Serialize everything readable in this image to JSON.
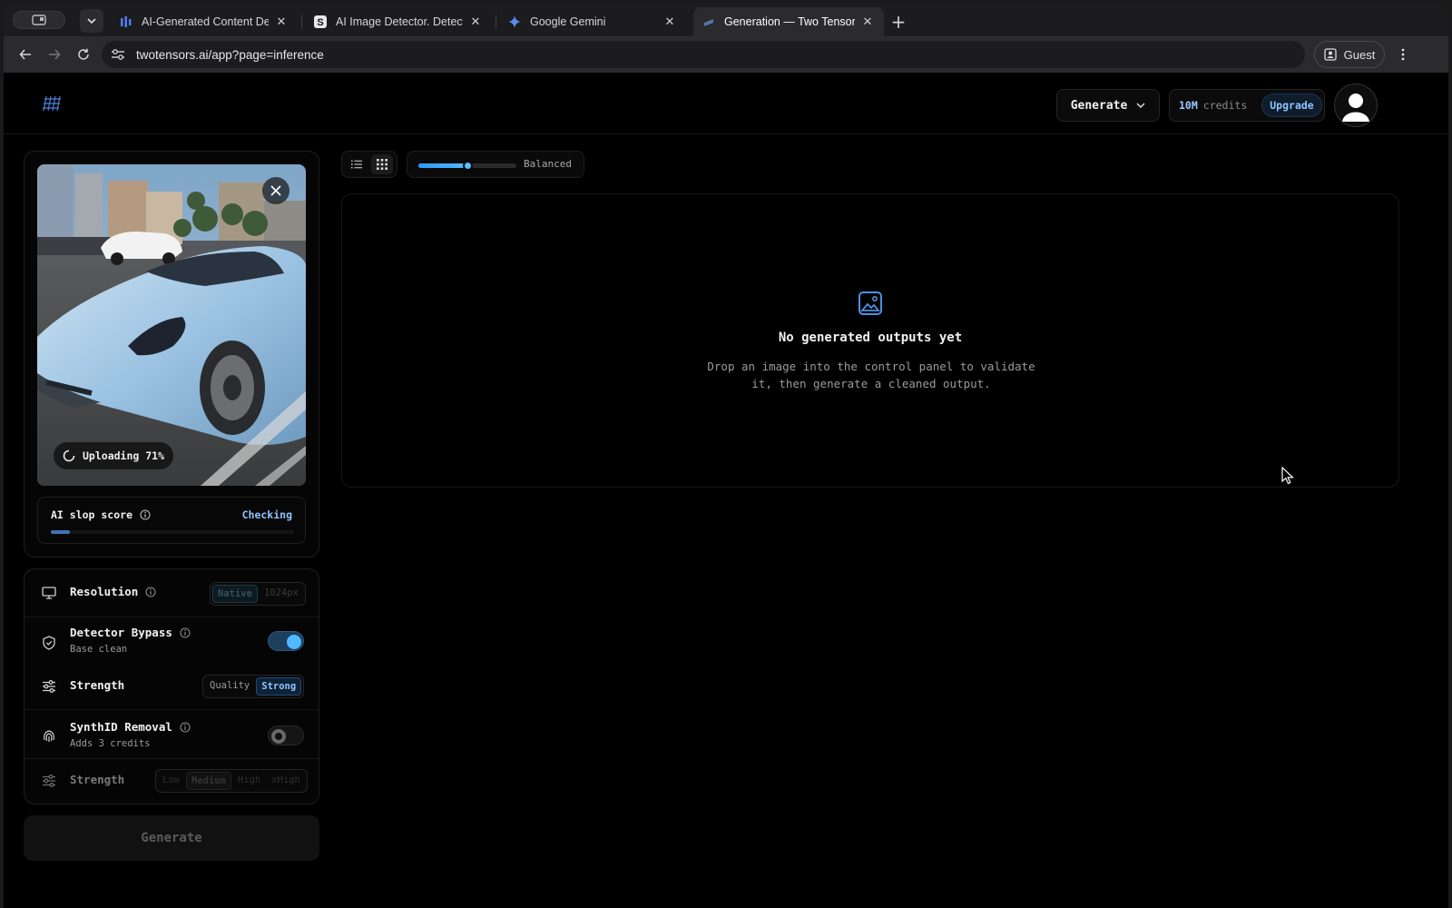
{
  "browser": {
    "tabs": [
      {
        "title": "AI-Generated Content Detect",
        "favicon": "bars-icon"
      },
      {
        "title": "AI Image Detector. Detect AI-",
        "favicon": "s-logo-icon"
      },
      {
        "title": "Google Gemini",
        "favicon": "gemini-icon"
      },
      {
        "title": "Generation — Two Tensors",
        "favicon": "twotensors-icon"
      }
    ],
    "active_tab": 3,
    "url": "twotensors.ai/app?page=inference",
    "profile_label": "Guest"
  },
  "header": {
    "mode_select": "Generate",
    "credits_amount": "10M",
    "credits_label": "credits",
    "upgrade_label": "Upgrade"
  },
  "upload": {
    "status_text": "Uploading 71%",
    "progress_percent": 71
  },
  "slop_score": {
    "label": "AI slop score",
    "status": "Checking",
    "progress_fraction": 0.08
  },
  "settings": {
    "resolution": {
      "label": "Resolution",
      "options": [
        "Native",
        "1024px"
      ],
      "selected": "Native"
    },
    "detector_bypass": {
      "label": "Detector Bypass",
      "sub": "Base clean",
      "enabled": true
    },
    "strength": {
      "label": "Strength",
      "options": [
        "Quality",
        "Strong"
      ],
      "selected": "Strong"
    },
    "synthid": {
      "label": "SynthID Removal",
      "sub": "Adds 3 credits",
      "enabled": false
    },
    "synthid_strength": {
      "label": "Strength",
      "options": [
        "Low",
        "Medium",
        "High",
        "xHigh"
      ],
      "selected": "Medium",
      "disabled": true
    }
  },
  "generate_button": "Generate",
  "view": {
    "mode": "grid",
    "quality_label": "Balanced",
    "quality_level": 0.5
  },
  "outputs": {
    "empty_title": "No generated outputs yet",
    "empty_line1": "Drop an image into the control panel to validate",
    "empty_line2": "it, then generate a cleaned output."
  },
  "colors": {
    "accent": "#52b8ff",
    "accent_text": "#8fc4ff"
  }
}
